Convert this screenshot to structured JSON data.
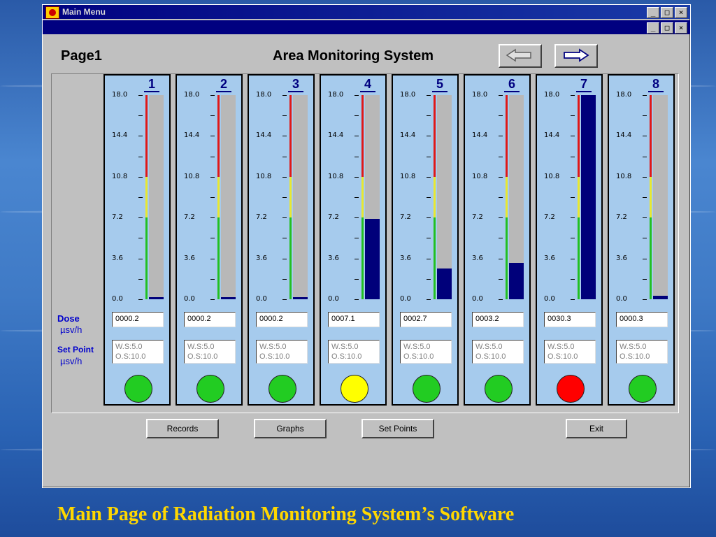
{
  "window": {
    "title": "Main Menu",
    "controls": [
      "_",
      "□",
      "×"
    ]
  },
  "header": {
    "page_label": "Page1",
    "app_title": "Area Monitoring System",
    "back_icon": "arrow-left-icon",
    "forward_icon": "arrow-right-icon"
  },
  "labels": {
    "dose": "Dose",
    "dose_unit": "µsv/h",
    "setpoint": "Set Point",
    "setpoint_unit": "µsv/h"
  },
  "scale": {
    "ticks": [
      "18.0",
      "14.4",
      "10.8",
      "7.2",
      "3.6",
      "0.0"
    ],
    "max": 18.0,
    "zones": {
      "green_max": 7.2,
      "yellow_max": 10.8,
      "red_max": 18.0
    },
    "zone_colors": {
      "green": "#22c022",
      "yellow": "#e8e830",
      "red": "#e01818"
    }
  },
  "channels": [
    {
      "num": "1",
      "dose": "0000.2",
      "value": 0.2,
      "ws": "W.S:5.0",
      "os": "O.S:10.0",
      "status": "green"
    },
    {
      "num": "2",
      "dose": "0000.2",
      "value": 0.2,
      "ws": "W.S:5.0",
      "os": "O.S:10.0",
      "status": "green"
    },
    {
      "num": "3",
      "dose": "0000.2",
      "value": 0.2,
      "ws": "W.S:5.0",
      "os": "O.S:10.0",
      "status": "green"
    },
    {
      "num": "4",
      "dose": "0007.1",
      "value": 7.1,
      "ws": "W.S:5.0",
      "os": "O.S:10.0",
      "status": "yellow"
    },
    {
      "num": "5",
      "dose": "0002.7",
      "value": 2.7,
      "ws": "W.S:5.0",
      "os": "O.S:10.0",
      "status": "green"
    },
    {
      "num": "6",
      "dose": "0003.2",
      "value": 3.2,
      "ws": "W.S:5.0",
      "os": "O.S:10.0",
      "status": "green"
    },
    {
      "num": "7",
      "dose": "0030.3",
      "value": 30.3,
      "ws": "W.S:5.0",
      "os": "O.S:10.0",
      "status": "red"
    },
    {
      "num": "8",
      "dose": "0000.3",
      "value": 0.3,
      "ws": "W.S:5.0",
      "os": "O.S:10.0",
      "status": "green"
    }
  ],
  "lamp_colors": {
    "green": "#22cc22",
    "yellow": "#ffff00",
    "red": "#ff0000"
  },
  "buttons": {
    "records": "Records",
    "graphs": "Graphs",
    "set_points": "Set Points",
    "exit": "Exit"
  },
  "caption": "Main Page of Radiation Monitoring System’s Software"
}
